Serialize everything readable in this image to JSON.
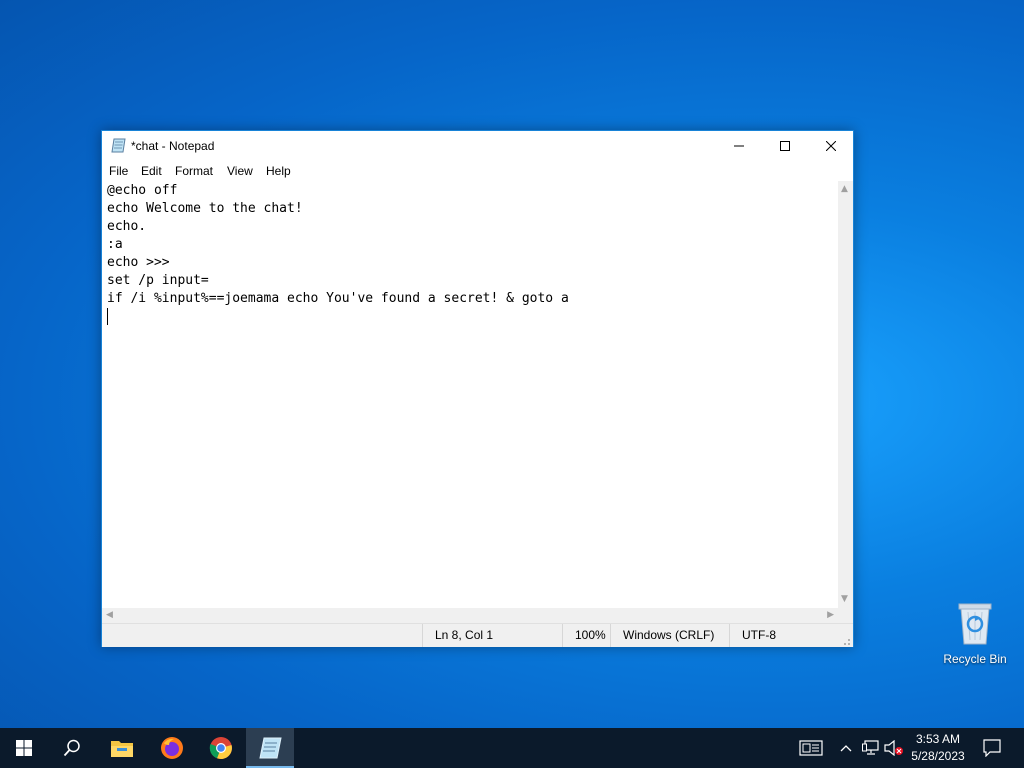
{
  "desktop": {
    "icons": [
      {
        "label": "Recycle Bin",
        "icon": "recycle-bin-icon"
      }
    ]
  },
  "window": {
    "title": "*chat - Notepad",
    "icon": "notepad-icon",
    "controls": {
      "minimize": "minimize-icon",
      "maximize": "maximize-icon",
      "close": "close-icon"
    },
    "menu": [
      "File",
      "Edit",
      "Format",
      "View",
      "Help"
    ],
    "editor": {
      "lines": [
        "@echo off",
        "echo Welcome to the chat!",
        "echo.",
        ":a",
        "echo >>>",
        "set /p input=",
        "if /i %input%==joemama echo You've found a secret! & goto a",
        ""
      ]
    },
    "status": {
      "position": "Ln 8, Col 1",
      "zoom": "100%",
      "line_ending": "Windows (CRLF)",
      "encoding": "UTF-8"
    }
  },
  "taskbar": {
    "apps": [
      "start-icon",
      "search-icon",
      "file-explorer-icon",
      "firefox-icon",
      "chrome-icon",
      "notepad-icon"
    ],
    "tray": [
      "news-icon",
      "chevron-up-icon",
      "network-icon",
      "volume-muted-icon",
      "notifications-icon"
    ],
    "clock": {
      "time": "3:53 AM",
      "date": "5/28/2023"
    }
  },
  "colors": {
    "taskbar_bg": "#0b1a2b",
    "window_border": "#1883d7",
    "desktop_blue": "#0a7fe0"
  }
}
